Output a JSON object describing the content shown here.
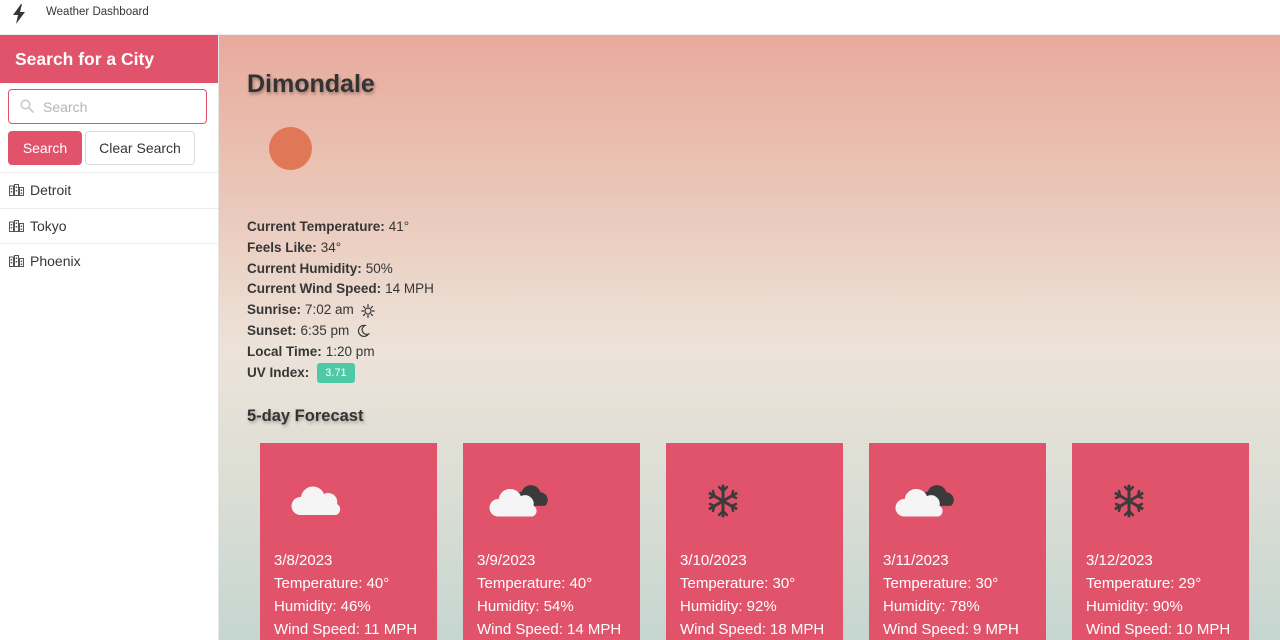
{
  "app": {
    "title": "Weather Dashboard"
  },
  "sidebar": {
    "header": "Search for a City",
    "search": {
      "placeholder": "Search",
      "value": ""
    },
    "search_button": "Search",
    "clear_button": "Clear Search",
    "cities": [
      {
        "label": "Detroit"
      },
      {
        "label": "Tokyo"
      },
      {
        "label": "Phoenix"
      }
    ]
  },
  "current": {
    "city": "Dimondale",
    "temperature_label": "Current Temperature:",
    "temperature": "41°",
    "feels_like_label": "Feels Like:",
    "feels_like": "34°",
    "humidity_label": "Current Humidity:",
    "humidity": "50%",
    "wind_label": "Current Wind Speed:",
    "wind": "14 MPH",
    "sunrise_label": "Sunrise:",
    "sunrise": "7:02 am",
    "sunset_label": "Sunset:",
    "sunset": "6:35 pm",
    "local_time_label": "Local Time:",
    "local_time": "1:20 pm",
    "uv_label": "UV Index:",
    "uv": "3.71"
  },
  "forecast": {
    "title": "5-day Forecast",
    "days": [
      {
        "icon": "cloud-icon",
        "date": "3/8/2023",
        "temp": "Temperature: 40°",
        "humidity": "Humidity: 46%",
        "wind": "Wind Speed: 11 MPH"
      },
      {
        "icon": "clouds-icon",
        "date": "3/9/2023",
        "temp": "Temperature: 40°",
        "humidity": "Humidity: 54%",
        "wind": "Wind Speed: 14 MPH"
      },
      {
        "icon": "snowflake-icon",
        "date": "3/10/2023",
        "temp": "Temperature: 30°",
        "humidity": "Humidity: 92%",
        "wind": "Wind Speed: 18 MPH"
      },
      {
        "icon": "clouds-icon",
        "date": "3/11/2023",
        "temp": "Temperature: 30°",
        "humidity": "Humidity: 78%",
        "wind": "Wind Speed: 9 MPH"
      },
      {
        "icon": "snowflake-icon",
        "date": "3/12/2023",
        "temp": "Temperature: 29°",
        "humidity": "Humidity: 90%",
        "wind": "Wind Speed: 10 MPH"
      }
    ]
  },
  "colors": {
    "accent": "#e1536b",
    "uv_badge": "#4ec9a6",
    "sun": "#e07858"
  }
}
